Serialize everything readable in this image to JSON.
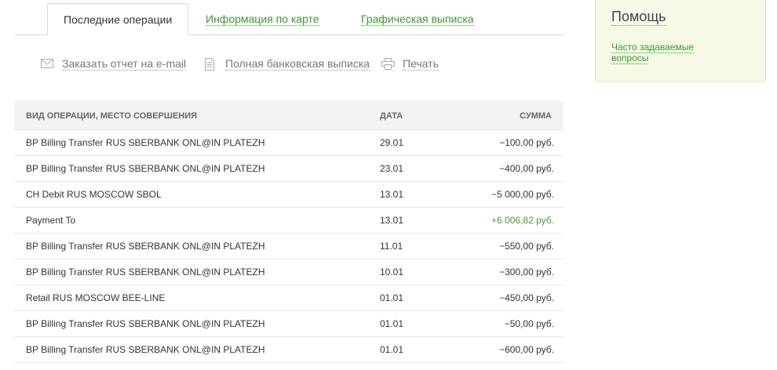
{
  "tabs": [
    {
      "label": "Последние операции",
      "active": true
    },
    {
      "label": "Информация по карте",
      "active": false
    },
    {
      "label": "Графическая выписка",
      "active": false
    }
  ],
  "actions": {
    "email": {
      "label": "Заказать отчет на e-mail",
      "icon": "envelope-icon"
    },
    "statement": {
      "label": "Полная банковская выписка",
      "icon": "document-icon"
    },
    "print": {
      "label": "Печать",
      "icon": "printer-icon"
    }
  },
  "table": {
    "headers": {
      "description": "ВИД ОПЕРАЦИИ, МЕСТО СОВЕРШЕНИЯ",
      "date": "ДАТА",
      "amount": "СУММА"
    },
    "rows": [
      {
        "description": "BP Billing Transfer RUS SBERBANK ONL@IN PLATEZH",
        "date": "29.01",
        "amount": "−100,00 руб.",
        "positive": false
      },
      {
        "description": "BP Billing Transfer RUS SBERBANK ONL@IN PLATEZH",
        "date": "23.01",
        "amount": "−400,00 руб.",
        "positive": false
      },
      {
        "description": "CH Debit RUS MOSCOW SBOL",
        "date": "13.01",
        "amount": "−5 000,00 руб.",
        "positive": false
      },
      {
        "description": "Payment To",
        "date": "13.01",
        "amount": "+6 006,82 руб.",
        "positive": true
      },
      {
        "description": "BP Billing Transfer RUS SBERBANK ONL@IN PLATEZH",
        "date": "11.01",
        "amount": "−550,00 руб.",
        "positive": false
      },
      {
        "description": "BP Billing Transfer RUS SBERBANK ONL@IN PLATEZH",
        "date": "10.01",
        "amount": "−300,00 руб.",
        "positive": false
      },
      {
        "description": "Retail RUS MOSCOW BEE-LINE",
        "date": "01.01",
        "amount": "−450,00 руб.",
        "positive": false
      },
      {
        "description": "BP Billing Transfer RUS SBERBANK ONL@IN PLATEZH",
        "date": "01.01",
        "amount": "−50,00 руб.",
        "positive": false
      },
      {
        "description": "BP Billing Transfer RUS SBERBANK ONL@IN PLATEZH",
        "date": "01.01",
        "amount": "−600,00 руб.",
        "positive": false
      }
    ]
  },
  "help": {
    "title": "Помощь",
    "faq_link": "Часто задаваемые вопросы"
  },
  "colors": {
    "accent_green": "#3a9a2c",
    "positive_amount": "#4d9a37",
    "help_bg": "#f5f9e6"
  }
}
